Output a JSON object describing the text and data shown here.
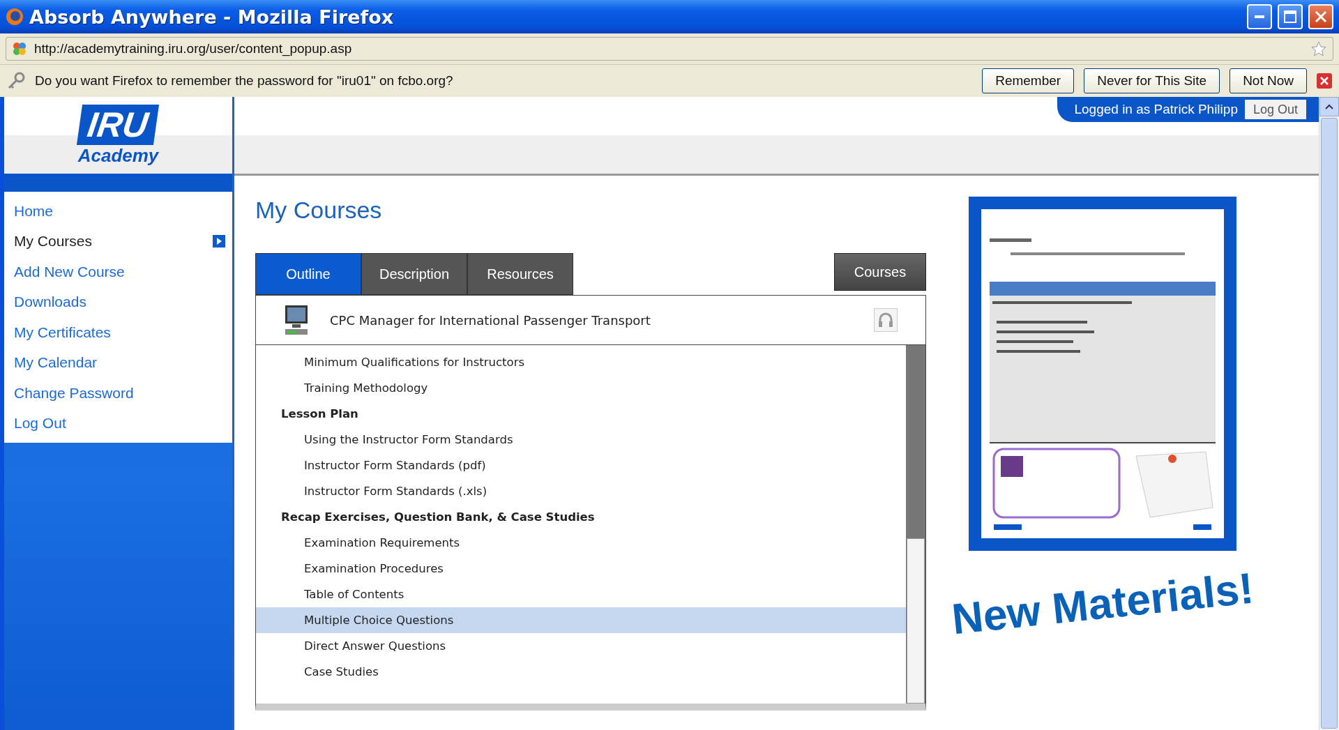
{
  "window": {
    "title": "Absorb Anywhere - Mozilla Firefox"
  },
  "address_bar": {
    "url": "http://academytraining.iru.org/user/content_popup.asp"
  },
  "password_bar": {
    "message": "Do you want Firefox to remember the password for \"iru01\" on fcbo.org?",
    "buttons": [
      "Remember",
      "Never for This Site",
      "Not Now"
    ]
  },
  "logo": {
    "title": "IRU",
    "subtitle": "Academy"
  },
  "user_bar": {
    "text": "Logged in as Patrick Philipp",
    "button": "Log Out"
  },
  "sidebar": {
    "items": [
      {
        "label": "Home",
        "selected": false
      },
      {
        "label": "My Courses",
        "selected": true
      },
      {
        "label": "Add New Course",
        "selected": false
      },
      {
        "label": "Downloads",
        "selected": false
      },
      {
        "label": "My Certificates",
        "selected": false
      },
      {
        "label": "My Calendar",
        "selected": false
      },
      {
        "label": "Change Password",
        "selected": false
      },
      {
        "label": "Log Out",
        "selected": false
      }
    ]
  },
  "page_title": "My Courses",
  "tabs": [
    {
      "label": "Outline",
      "selected": true
    },
    {
      "label": "Description",
      "selected": false
    },
    {
      "label": "Resources",
      "selected": false
    }
  ],
  "courses_button": "Courses",
  "course": {
    "title": "CPC Manager for International Passenger Transport"
  },
  "outline": [
    {
      "kind": "item",
      "label": "Minimum Qualifications for Instructors",
      "selected": false
    },
    {
      "kind": "item",
      "label": "Training Methodology",
      "selected": false
    },
    {
      "kind": "section",
      "label": "Lesson Plan",
      "children": [
        {
          "kind": "item",
          "label": "Using the Instructor Form Standards",
          "selected": false
        },
        {
          "kind": "item",
          "label": "Instructor Form Standards (pdf)",
          "selected": false
        },
        {
          "kind": "item",
          "label": "Instructor Form Standards (.xls)",
          "selected": false
        }
      ]
    },
    {
      "kind": "section",
      "label": "Recap Exercises, Question Bank, & Case Studies",
      "children": [
        {
          "kind": "item",
          "label": "Examination Requirements",
          "selected": false
        },
        {
          "kind": "item",
          "label": "Examination Procedures",
          "selected": false
        },
        {
          "kind": "item",
          "label": "Table of Contents",
          "selected": false
        },
        {
          "kind": "item",
          "label": "Multiple Choice Questions",
          "selected": true
        },
        {
          "kind": "item",
          "label": "Direct Answer Questions",
          "selected": false
        },
        {
          "kind": "item",
          "label": "Case Studies",
          "selected": false
        }
      ]
    }
  ],
  "promo": {
    "headline": "New Materials!"
  }
}
